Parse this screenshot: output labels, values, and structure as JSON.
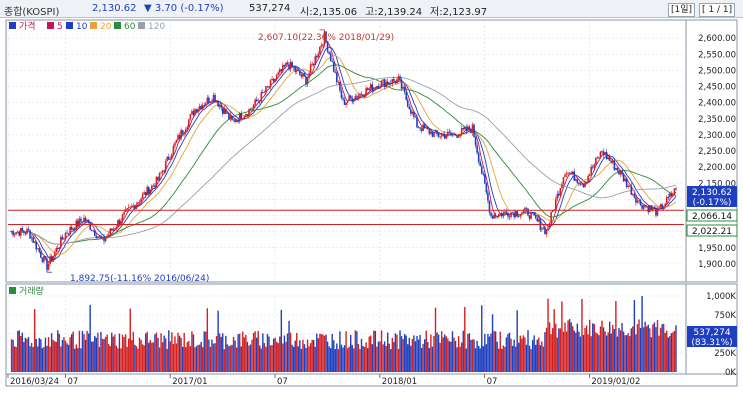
{
  "header": {
    "name": "종합(KOSPI)",
    "price": "2,130.62",
    "change": "▼ 3.70 (-0.17%)",
    "volume": "537,274",
    "open": "시:2,135.06",
    "high": "고:2,139.24",
    "low": "저:2,123.97",
    "period": "[1일]",
    "page": "[ 1 / 1]"
  },
  "legend": {
    "price_label": "가격",
    "ma": [
      {
        "label": "5",
        "color": "#c2185b"
      },
      {
        "label": "10",
        "color": "#1e3fbf"
      },
      {
        "label": "20",
        "color": "#e8a33c"
      },
      {
        "label": "60",
        "color": "#2e8b3a"
      },
      {
        "label": "120",
        "color": "#9aa0a8"
      }
    ]
  },
  "volume_panel": {
    "title": "거래량"
  },
  "chart_data": {
    "type": "line",
    "title": "",
    "price": {
      "ylim": [
        1850,
        2650
      ],
      "yticks": [
        "2,600.00",
        "2,550.00",
        "2,500.00",
        "2,450.00",
        "2,400.00",
        "2,350.00",
        "2,300.00",
        "2,250.00",
        "2,200.00",
        "2,150.00",
        "2,100.00",
        "2,050.00",
        "2,000.00",
        "1,950.00",
        "1,900.00"
      ],
      "series": [
        {
          "name": "가격",
          "color": "#1e3fbf",
          "x": [
            "2016/03/24",
            "2016/05",
            "2016/06/24",
            "2016/07",
            "2016/09",
            "2016/11",
            "2017/01",
            "2017/03",
            "2017/04",
            "2017/05",
            "2017/06",
            "2017/07",
            "2017/08",
            "2017/09",
            "2017/10",
            "2017/11",
            "2017/12",
            "2018/01/29",
            "2018/02",
            "2018/03",
            "2018/04",
            "2018/05",
            "2018/06",
            "2018/07",
            "2018/08",
            "2018/09",
            "2018/10",
            "2018/11",
            "2018/12",
            "2019/01/02",
            "2019/02",
            "2019/03",
            "2019/04",
            "2019/05",
            "2019/06",
            "2019/07",
            "2019/08"
          ],
          "values": [
            2000,
            2000,
            1893,
            1995,
            2040,
            1970,
            2040,
            2100,
            2160,
            2280,
            2380,
            2420,
            2340,
            2380,
            2450,
            2520,
            2470,
            2607,
            2400,
            2430,
            2460,
            2470,
            2330,
            2300,
            2300,
            2320,
            2050,
            2060,
            2060,
            2000,
            2190,
            2150,
            2250,
            2180,
            2090,
            2060,
            2131
          ]
        }
      ],
      "hlines": [
        {
          "value": 2066.14,
          "label": "2,066.14",
          "color": "#d42020"
        },
        {
          "value": 2022.21,
          "label": "2,022.21",
          "color": "#d42020"
        }
      ],
      "current": {
        "value": 2130.62,
        "label": "2,130.62",
        "sub": "(-0.17%)"
      },
      "annotations": [
        {
          "text": "2,607.10(22.36% 2018/01/29)",
          "x": "2018/01/29",
          "y": 2607.1
        },
        {
          "text": "1,892.75(-11.16% 2016/06/24)",
          "x": "2016/06/24",
          "y": 1892.75
        }
      ]
    },
    "volume": {
      "ylim": [
        0,
        1000000
      ],
      "yticks": [
        "1,000K",
        "750K",
        "500K",
        "250K",
        "0K"
      ],
      "current": {
        "label": "537,274",
        "sub": "(83.31%)"
      }
    },
    "xticks": [
      "2016/03/24",
      "07",
      "2017/01",
      "07",
      "2018/01",
      "07",
      "2019/01/02"
    ]
  }
}
